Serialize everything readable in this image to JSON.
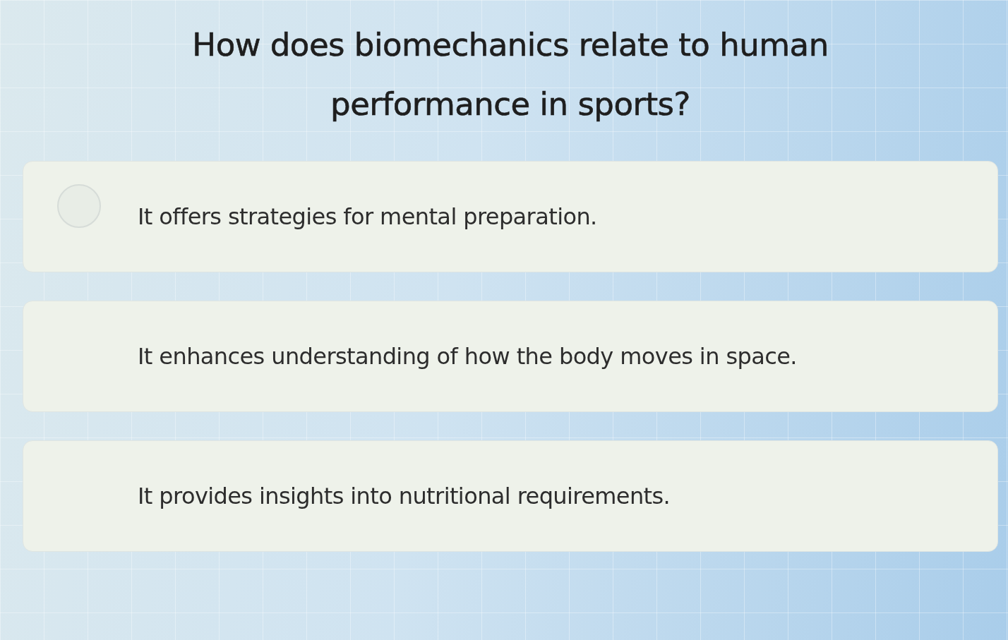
{
  "question": {
    "text": "How does biomechanics relate to human performance in sports?"
  },
  "options": [
    {
      "text": "It offers strategies for mental preparation.",
      "selected": false,
      "radio": true
    },
    {
      "text": "It enhances understanding of how the body moves in space.",
      "selected": false,
      "radio": false
    },
    {
      "text": "It provides insights into nutritional requirements.",
      "selected": false,
      "radio": false
    }
  ]
}
